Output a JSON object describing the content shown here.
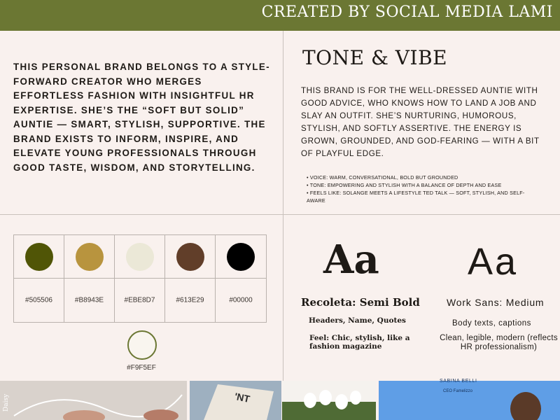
{
  "header": {
    "title": "CREATED BY SOCIAL MEDIA LAMI"
  },
  "intro": {
    "text": "THIS PERSONAL BRAND BELONGS TO A STYLE-FORWARD CREATOR WHO MERGES EFFORTLESS FASHION WITH INSIGHTFUL HR EXPERTISE. SHE’S THE “SOFT BUT SOLID” AUNTIE — SMART, STYLISH, SUPPORTIVE. THE BRAND EXISTS TO INFORM, INSPIRE, AND ELEVATE YOUNG PROFESSIONALS THROUGH GOOD TASTE, WISDOM, AND STORYTELLING."
  },
  "tone": {
    "title": "TONE & VIBE",
    "paragraph": "THIS BRAND IS FOR THE WELL-DRESSED AUNTIE WITH GOOD ADVICE, WHO KNOWS HOW TO LAND A JOB AND SLAY AN OUTFIT. SHE’S NURTURING, HUMOROUS, STYLISH, AND SOFTLY ASSERTIVE. THE ENERGY IS GROWN, GROUNDED, AND GOD-FEARING — WITH A BIT OF PLAYFUL EDGE.",
    "bullets": [
      "• VOICE: WARM, CONVERSATIONAL, BOLD BUT GROUNDED",
      "• TONE: EMPOWERING AND STYLISH WITH A BALANCE OF DEPTH AND EASE",
      "• FEELS LIKE: SOLANGE MEETS A LIFESTYLE TED TALK — SOFT, STYLISH, AND SELF-AWARE"
    ]
  },
  "palette": {
    "colors": [
      {
        "hex": "#505506",
        "label": "#505506"
      },
      {
        "hex": "#B8943E",
        "label": "#B8943E"
      },
      {
        "hex": "#EBE8D7",
        "label": "#EBE8D7"
      },
      {
        "hex": "#613E29",
        "label": "#613E29"
      },
      {
        "hex": "#00000",
        "label": "#00000"
      }
    ],
    "extra": {
      "hex": "#F9F5EF",
      "label": "#F9F5EF"
    }
  },
  "typography": {
    "serif": {
      "sample": "Aa",
      "name": "Recoleta: Semi Bold",
      "usage": "Headers, Name, Quotes",
      "feel": "Feel: Chic, stylish, like a fashion magazine"
    },
    "sans": {
      "sample": "Aa",
      "name": "Work Sans: Medium",
      "usage": "Body texts, captions",
      "feel": "Clean, legible, modern (reflects HR professionalism)"
    }
  },
  "photos": {
    "p1_caption": "Daisy",
    "p2_caption": "'NT",
    "p4_name": "SABINA BELLI",
    "p4_role": "CEO Famelizzo"
  },
  "colors": {
    "banner": "#6b7733",
    "background": "#f9f1ee"
  }
}
